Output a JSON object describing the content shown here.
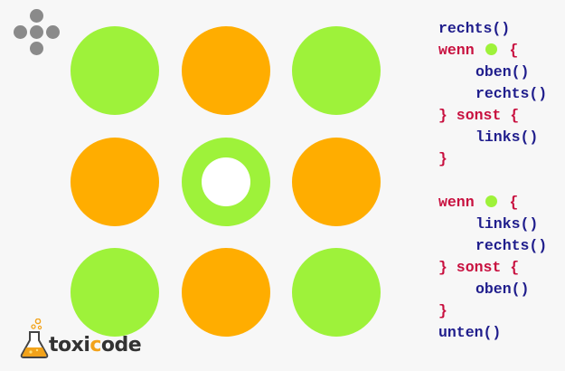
{
  "colors": {
    "green": "#9ef23a",
    "orange": "#ffad00",
    "white": "#ffffff",
    "keyword": "#c8103f",
    "function": "#1f1d8c",
    "dpad": "#8a8a8a"
  },
  "board": {
    "rows": [
      [
        {
          "color": "green"
        },
        {
          "color": "orange"
        },
        {
          "color": "green"
        }
      ],
      [
        {
          "color": "orange"
        },
        {
          "color": "green",
          "player": true
        },
        {
          "color": "orange"
        }
      ],
      [
        {
          "color": "green"
        },
        {
          "color": "orange"
        },
        {
          "color": "green"
        }
      ]
    ]
  },
  "code": {
    "lines": [
      {
        "text": "rechts()",
        "kind": "fn",
        "indent": 0
      },
      {
        "text": "wenn",
        "kind": "kw",
        "indent": 0,
        "swatch": "green",
        "suffix": "{"
      },
      {
        "text": "oben()",
        "kind": "fn",
        "indent": 1
      },
      {
        "text": "rechts()",
        "kind": "fn",
        "indent": 1
      },
      {
        "text": "} sonst {",
        "kind": "kw",
        "indent": 0
      },
      {
        "text": "links()",
        "kind": "fn",
        "indent": 1
      },
      {
        "text": "}",
        "kind": "kw",
        "indent": 0
      },
      {
        "text": "",
        "kind": "blank",
        "indent": 0
      },
      {
        "text": "wenn",
        "kind": "kw",
        "indent": 0,
        "swatch": "green",
        "suffix": "{"
      },
      {
        "text": "links()",
        "kind": "fn",
        "indent": 1
      },
      {
        "text": "rechts()",
        "kind": "fn",
        "indent": 1
      },
      {
        "text": "} sonst {",
        "kind": "kw",
        "indent": 0
      },
      {
        "text": "oben()",
        "kind": "fn",
        "indent": 1
      },
      {
        "text": "}",
        "kind": "kw",
        "indent": 0
      },
      {
        "text": "unten()",
        "kind": "fn",
        "indent": 0
      }
    ]
  },
  "logo": {
    "text_before": "toxi",
    "text_accent": "c",
    "text_after": "ode"
  },
  "icons": {
    "dpad": "dpad-icon",
    "logo": "flask-icon"
  }
}
